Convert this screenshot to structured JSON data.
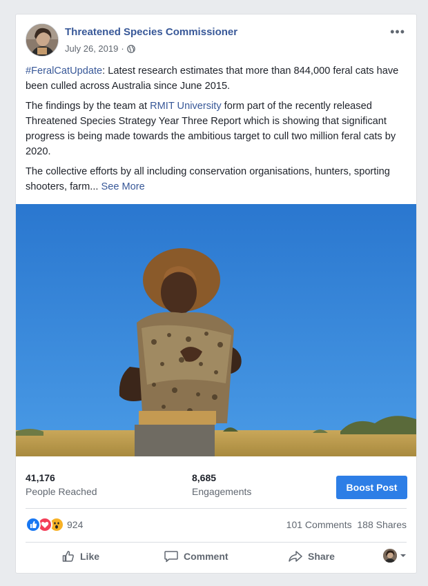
{
  "post": {
    "page_name": "Threatened Species Commissioner",
    "date": "July 26, 2019",
    "date_separator": "·",
    "more_label": "•••",
    "paragraphs": {
      "p1_hashtag": "#FeralCatUpdate",
      "p1_text": ": Latest research estimates that more than 844,000 feral cats have been culled across Australia since June 2015.",
      "p2_before": "The findings by the team at ",
      "p2_link": "RMIT University",
      "p2_after": " form part of the recently released Threatened Species Strategy Year Three Report which is showing that significant progress is being made towards the ambitious target to cull two million feral cats by 2020.",
      "p3_text": "The collective efforts by all including conservation organisations, hunters, sporting shooters, farm...",
      "see_more": "See More"
    }
  },
  "insights": {
    "reached_value": "41,176",
    "reached_label": "People Reached",
    "engagements_value": "8,685",
    "engagements_label": "Engagements",
    "boost_label": "Boost Post"
  },
  "reactions": {
    "icons": [
      "like-reaction-icon",
      "love-reaction-icon",
      "wow-reaction-icon"
    ],
    "count": "924",
    "comments": "101 Comments",
    "shares": "188 Shares"
  },
  "actions": {
    "like_label": "Like",
    "comment_label": "Comment",
    "share_label": "Share"
  },
  "colors": {
    "link": "#385898",
    "boost": "#2d7ee6",
    "sky": "#2f80d6",
    "like": "#1877f2",
    "love": "#f33e58",
    "wow": "#f7b125"
  }
}
